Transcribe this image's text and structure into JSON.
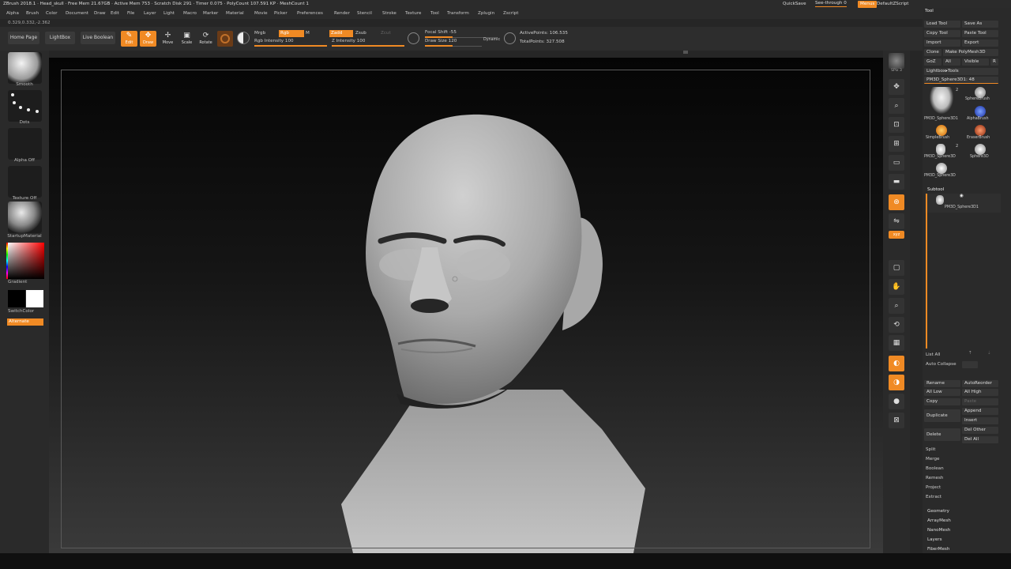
{
  "titlebar": {
    "text": "ZBrush 2018.1 · Head_skull · Free Mem 21.67GB · Active Mem 753 · Scratch Disk 291 · Timer 0.075 · PolyCount 107.591 KP · MeshCount 1",
    "quicksave": "QuickSave",
    "seethrough": "See-through 0",
    "menus": "Menus",
    "zscript": "DefaultZScript"
  },
  "menus": [
    "Alpha",
    "Brush",
    "Color",
    "Document",
    "Draw",
    "Edit",
    "File",
    "Layer",
    "Light",
    "Macro",
    "Marker",
    "Material",
    "Movie",
    "Picker",
    "Preferences",
    "Render",
    "Stencil",
    "Stroke",
    "Texture",
    "Tool",
    "Transform",
    "Zplugin",
    "Zscript"
  ],
  "coords": "0.329,0.332,-2.362",
  "shelf": {
    "home": "Home Page",
    "lightbox": "LightBox",
    "liveboolean": "Live Boolean",
    "modes": [
      {
        "icon": "✎",
        "label": "Edit",
        "active": true
      },
      {
        "icon": "✥",
        "label": "Draw",
        "active": true
      },
      {
        "icon": "✢",
        "label": "Move",
        "active": false
      },
      {
        "icon": "▣",
        "label": "Scale",
        "active": false
      },
      {
        "icon": "⟳",
        "label": "Rotate",
        "active": false
      }
    ],
    "mrgb": "Mrgb",
    "rgb": "Rgb",
    "m": "M",
    "rgb_intensity": "Rgb Intensity 100",
    "zadd": "Zadd",
    "zsub": "Zsub",
    "zcut": "Zcut",
    "z_intensity": "Z Intensity 100",
    "focal_shift": "Focal Shift -55",
    "draw_size": "Draw Size 120",
    "dynamic": "Dynamic",
    "active_points": "ActivePoints: 106.535",
    "total_points": "TotalPoints: 327.508"
  },
  "left": {
    "brush": "Smooth",
    "stroke": "Dots",
    "alpha": "Alpha Off",
    "texture": "Texture Off",
    "material": "StartupMaterial",
    "gradient": "Gradient",
    "switchcolor": "SwitchColor",
    "alternate": "Alternate"
  },
  "right_strip": [
    {
      "label": "SPix 3",
      "icon": "◼"
    },
    {
      "label": "Scroll",
      "icon": "✥"
    },
    {
      "label": "Zoom",
      "icon": "⌕"
    },
    {
      "label": "Actual",
      "icon": "⊡"
    },
    {
      "label": "AAHalf",
      "icon": "⊞"
    },
    {
      "label": "Persp",
      "icon": "▭"
    },
    {
      "label": "Floor",
      "icon": "▬"
    },
    {
      "label": "Local",
      "icon": "⊛"
    },
    {
      "label": "L.Sym",
      "icon": "⇋"
    },
    {
      "label": "Qxyz",
      "icon": "xyz"
    },
    {
      "label": "Frame",
      "icon": "▢"
    },
    {
      "label": "Move",
      "icon": "✋"
    },
    {
      "label": "Zoom3D",
      "icon": "⌕"
    },
    {
      "label": "Rotate",
      "icon": "⟲"
    },
    {
      "label": "Line Fill PolyF",
      "icon": "▦"
    },
    {
      "label": "Transp",
      "icon": "◐"
    },
    {
      "label": "Ghost",
      "icon": "◑"
    },
    {
      "label": "Solo",
      "icon": "●"
    },
    {
      "label": "Xpose",
      "icon": "⊠"
    }
  ],
  "tool": {
    "title": "Tool",
    "load": "Load Tool",
    "saveas": "Save As",
    "copy": "Copy Tool",
    "paste": "Paste Tool",
    "import": "Import",
    "export": "Export",
    "clone": "Clone",
    "makepoly": "Make PolyMesh3D",
    "goz": "GoZ",
    "all": "All",
    "visible": "Visible",
    "r": "R",
    "lightboxtools": "Lightbox▸Tools",
    "current": "PM3D_Sphere3D1: 48",
    "thumbs": [
      {
        "label": "PM3D_Sphere3D1",
        "count": "2"
      },
      {
        "label": "SphereBrush"
      },
      {
        "label": "AlphaBrush"
      },
      {
        "label": "SimpleBrush"
      },
      {
        "label": "EraserBrush"
      },
      {
        "label": "PM3D_Sphere3D",
        "count": "2"
      },
      {
        "label": "Sphere3D"
      },
      {
        "label": "PM3D_Sphere3D"
      }
    ],
    "subtool": "Subtool",
    "subtool_item": "PM3D_Sphere3D1",
    "listall": "List All",
    "autocollapse": "Auto Collapse",
    "rename": "Rename",
    "autoreorder": "AutoReorder",
    "alllow": "All Low",
    "allhigh": "All High",
    "copy2": "Copy",
    "paste2": "Paste",
    "duplicate": "Duplicate",
    "append": "Append",
    "insert": "Insert",
    "delete": "Delete",
    "delother": "Del Other",
    "delall": "Del All",
    "sections1": [
      "Split",
      "Merge",
      "Boolean",
      "Remesh",
      "Project",
      "Extract"
    ],
    "sections2": [
      "Geometry",
      "ArrayMesh",
      "NanoMesh",
      "Layers",
      "FiberMesh"
    ]
  }
}
